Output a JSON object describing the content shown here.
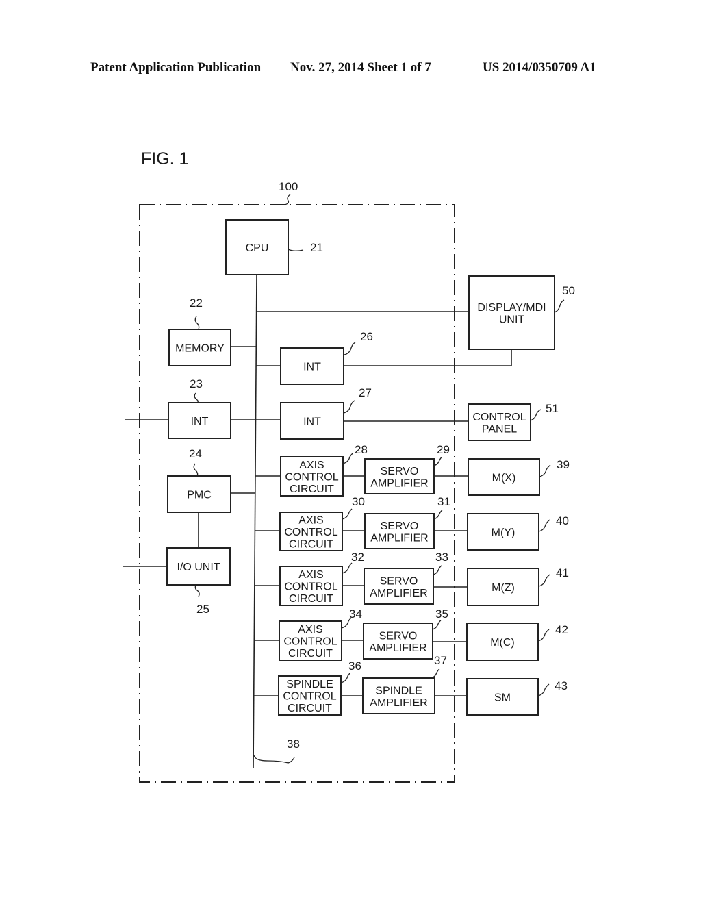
{
  "header": {
    "publication": "Patent Application Publication",
    "date_sheet": "Nov. 27, 2014   Sheet 1 of 7",
    "number": "US 2014/0350709 A1"
  },
  "figure": {
    "title": "FIG. 1",
    "controller_ref": "100",
    "bus_ref": "38",
    "blocks": {
      "cpu": {
        "label": [
          "CPU"
        ],
        "ref": "21"
      },
      "memory": {
        "label": [
          "MEMORY"
        ],
        "ref": "22"
      },
      "int23": {
        "label": [
          "INT"
        ],
        "ref": "23"
      },
      "pmc": {
        "label": [
          "PMC"
        ],
        "ref": "24"
      },
      "io": {
        "label": [
          "I/O UNIT"
        ],
        "ref": "25"
      },
      "int26": {
        "label": [
          "INT"
        ],
        "ref": "26"
      },
      "int27": {
        "label": [
          "INT"
        ],
        "ref": "27"
      },
      "axis28": {
        "label": [
          "AXIS",
          "CONTROL",
          "CIRCUIT"
        ],
        "ref": "28"
      },
      "servo29": {
        "label": [
          "SERVO",
          "AMPLIFIER"
        ],
        "ref": "29"
      },
      "axis30": {
        "label": [
          "AXIS",
          "CONTROL",
          "CIRCUIT"
        ],
        "ref": "30"
      },
      "servo31": {
        "label": [
          "SERVO",
          "AMPLIFIER"
        ],
        "ref": "31"
      },
      "axis32": {
        "label": [
          "AXIS",
          "CONTROL",
          "CIRCUIT"
        ],
        "ref": "32"
      },
      "servo33": {
        "label": [
          "SERVO",
          "AMPLIFIER"
        ],
        "ref": "33"
      },
      "axis34": {
        "label": [
          "AXIS",
          "CONTROL",
          "CIRCUIT"
        ],
        "ref": "34"
      },
      "servo35": {
        "label": [
          "SERVO",
          "AMPLIFIER"
        ],
        "ref": "35"
      },
      "spindle36": {
        "label": [
          "SPINDLE",
          "CONTROL",
          "CIRCUIT"
        ],
        "ref": "36"
      },
      "spindle37": {
        "label": [
          "SPINDLE",
          "AMPLIFIER"
        ],
        "ref": "37"
      },
      "motor39": {
        "label": [
          "M(X)"
        ],
        "ref": "39"
      },
      "motor40": {
        "label": [
          "M(Y)"
        ],
        "ref": "40"
      },
      "motor41": {
        "label": [
          "M(Z)"
        ],
        "ref": "41"
      },
      "motor42": {
        "label": [
          "M(C)"
        ],
        "ref": "42"
      },
      "sm43": {
        "label": [
          "SM"
        ],
        "ref": "43"
      },
      "display50": {
        "label": [
          "DISPLAY/MDI",
          "UNIT"
        ],
        "ref": "50"
      },
      "panel51": {
        "label": [
          "CONTROL",
          "PANEL"
        ],
        "ref": "51"
      }
    }
  }
}
